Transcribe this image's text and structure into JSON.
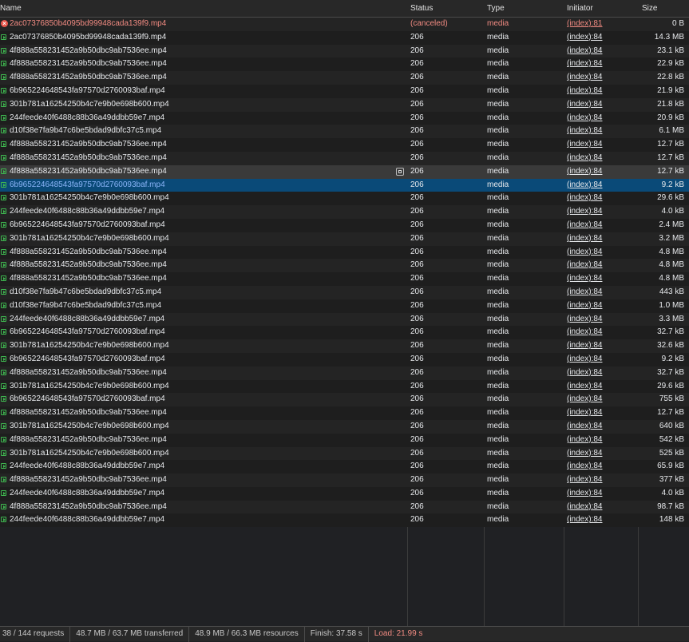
{
  "columns": {
    "name": "Name",
    "status": "Status",
    "type": "Type",
    "initiator": "Initiator",
    "size": "Size"
  },
  "rows": [
    {
      "name": "2ac07376850b4095bd99948cada139f9.mp4",
      "status": "(canceled)",
      "type": "media",
      "initiator": "(index):81",
      "size": "0 B",
      "state": "error"
    },
    {
      "name": "2ac07376850b4095bd99948cada139f9.mp4",
      "status": "206",
      "type": "media",
      "initiator": "(index):84",
      "size": "14.3 MB"
    },
    {
      "name": "4f888a558231452a9b50dbc9ab7536ee.mp4",
      "status": "206",
      "type": "media",
      "initiator": "(index):84",
      "size": "23.1 kB"
    },
    {
      "name": "4f888a558231452a9b50dbc9ab7536ee.mp4",
      "status": "206",
      "type": "media",
      "initiator": "(index):84",
      "size": "22.9 kB"
    },
    {
      "name": "4f888a558231452a9b50dbc9ab7536ee.mp4",
      "status": "206",
      "type": "media",
      "initiator": "(index):84",
      "size": "22.8 kB"
    },
    {
      "name": "6b965224648543fa97570d2760093baf.mp4",
      "status": "206",
      "type": "media",
      "initiator": "(index):84",
      "size": "21.9 kB"
    },
    {
      "name": "301b781a16254250b4c7e9b0e698b600.mp4",
      "status": "206",
      "type": "media",
      "initiator": "(index):84",
      "size": "21.8 kB"
    },
    {
      "name": "244feede40f6488c88b36a49ddbb59e7.mp4",
      "status": "206",
      "type": "media",
      "initiator": "(index):84",
      "size": "20.9 kB"
    },
    {
      "name": "d10f38e7fa9b47c6be5bdad9dbfc37c5.mp4",
      "status": "206",
      "type": "media",
      "initiator": "(index):84",
      "size": "6.1 MB"
    },
    {
      "name": "4f888a558231452a9b50dbc9ab7536ee.mp4",
      "status": "206",
      "type": "media",
      "initiator": "(index):84",
      "size": "12.7 kB"
    },
    {
      "name": "4f888a558231452a9b50dbc9ab7536ee.mp4",
      "status": "206",
      "type": "media",
      "initiator": "(index):84",
      "size": "12.7 kB"
    },
    {
      "name": "4f888a558231452a9b50dbc9ab7536ee.mp4",
      "status": "206",
      "type": "media",
      "initiator": "(index):84",
      "size": "12.7 kB",
      "state": "hover"
    },
    {
      "name": "6b965224648543fa97570d2760093baf.mp4",
      "status": "206",
      "type": "media",
      "initiator": "(index):84",
      "size": "9.2 kB",
      "state": "selected"
    },
    {
      "name": "301b781a16254250b4c7e9b0e698b600.mp4",
      "status": "206",
      "type": "media",
      "initiator": "(index):84",
      "size": "29.6 kB"
    },
    {
      "name": "244feede40f6488c88b36a49ddbb59e7.mp4",
      "status": "206",
      "type": "media",
      "initiator": "(index):84",
      "size": "4.0 kB"
    },
    {
      "name": "6b965224648543fa97570d2760093baf.mp4",
      "status": "206",
      "type": "media",
      "initiator": "(index):84",
      "size": "2.4 MB"
    },
    {
      "name": "301b781a16254250b4c7e9b0e698b600.mp4",
      "status": "206",
      "type": "media",
      "initiator": "(index):84",
      "size": "3.2 MB"
    },
    {
      "name": "4f888a558231452a9b50dbc9ab7536ee.mp4",
      "status": "206",
      "type": "media",
      "initiator": "(index):84",
      "size": "4.8 MB"
    },
    {
      "name": "4f888a558231452a9b50dbc9ab7536ee.mp4",
      "status": "206",
      "type": "media",
      "initiator": "(index):84",
      "size": "4.8 MB"
    },
    {
      "name": "4f888a558231452a9b50dbc9ab7536ee.mp4",
      "status": "206",
      "type": "media",
      "initiator": "(index):84",
      "size": "4.8 MB"
    },
    {
      "name": "d10f38e7fa9b47c6be5bdad9dbfc37c5.mp4",
      "status": "206",
      "type": "media",
      "initiator": "(index):84",
      "size": "443 kB"
    },
    {
      "name": "d10f38e7fa9b47c6be5bdad9dbfc37c5.mp4",
      "status": "206",
      "type": "media",
      "initiator": "(index):84",
      "size": "1.0 MB"
    },
    {
      "name": "244feede40f6488c88b36a49ddbb59e7.mp4",
      "status": "206",
      "type": "media",
      "initiator": "(index):84",
      "size": "3.3 MB"
    },
    {
      "name": "6b965224648543fa97570d2760093baf.mp4",
      "status": "206",
      "type": "media",
      "initiator": "(index):84",
      "size": "32.7 kB"
    },
    {
      "name": "301b781a16254250b4c7e9b0e698b600.mp4",
      "status": "206",
      "type": "media",
      "initiator": "(index):84",
      "size": "32.6 kB"
    },
    {
      "name": "6b965224648543fa97570d2760093baf.mp4",
      "status": "206",
      "type": "media",
      "initiator": "(index):84",
      "size": "9.2 kB"
    },
    {
      "name": "4f888a558231452a9b50dbc9ab7536ee.mp4",
      "status": "206",
      "type": "media",
      "initiator": "(index):84",
      "size": "32.7 kB"
    },
    {
      "name": "301b781a16254250b4c7e9b0e698b600.mp4",
      "status": "206",
      "type": "media",
      "initiator": "(index):84",
      "size": "29.6 kB"
    },
    {
      "name": "6b965224648543fa97570d2760093baf.mp4",
      "status": "206",
      "type": "media",
      "initiator": "(index):84",
      "size": "755 kB"
    },
    {
      "name": "4f888a558231452a9b50dbc9ab7536ee.mp4",
      "status": "206",
      "type": "media",
      "initiator": "(index):84",
      "size": "12.7 kB"
    },
    {
      "name": "301b781a16254250b4c7e9b0e698b600.mp4",
      "status": "206",
      "type": "media",
      "initiator": "(index):84",
      "size": "640 kB"
    },
    {
      "name": "4f888a558231452a9b50dbc9ab7536ee.mp4",
      "status": "206",
      "type": "media",
      "initiator": "(index):84",
      "size": "542 kB"
    },
    {
      "name": "301b781a16254250b4c7e9b0e698b600.mp4",
      "status": "206",
      "type": "media",
      "initiator": "(index):84",
      "size": "525 kB"
    },
    {
      "name": "244feede40f6488c88b36a49ddbb59e7.mp4",
      "status": "206",
      "type": "media",
      "initiator": "(index):84",
      "size": "65.9 kB"
    },
    {
      "name": "4f888a558231452a9b50dbc9ab7536ee.mp4",
      "status": "206",
      "type": "media",
      "initiator": "(index):84",
      "size": "377 kB"
    },
    {
      "name": "244feede40f6488c88b36a49ddbb59e7.mp4",
      "status": "206",
      "type": "media",
      "initiator": "(index):84",
      "size": "4.0 kB"
    },
    {
      "name": "4f888a558231452a9b50dbc9ab7536ee.mp4",
      "status": "206",
      "type": "media",
      "initiator": "(index):84",
      "size": "98.7 kB"
    },
    {
      "name": "244feede40f6488c88b36a49ddbb59e7.mp4",
      "status": "206",
      "type": "media",
      "initiator": "(index):84",
      "size": "148 kB"
    }
  ],
  "statusbar": {
    "requests": "38 / 144 requests",
    "transferred": "48.7 MB / 63.7 MB transferred",
    "resources": "48.9 MB / 66.3 MB resources",
    "finish": "Finish: 37.58 s",
    "load": "Load: 21.99 s"
  },
  "colors": {
    "error": "#f28b82",
    "selected_row": "#0a4a78",
    "media_icon": "#3fb950"
  }
}
